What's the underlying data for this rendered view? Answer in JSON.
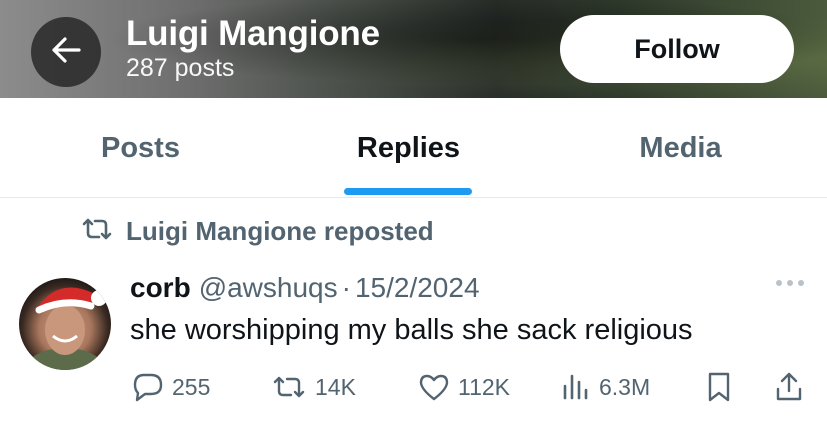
{
  "header": {
    "name": "Luigi Mangione",
    "post_count": "287 posts",
    "follow_label": "Follow"
  },
  "tabs": [
    {
      "label": "Posts",
      "active": false
    },
    {
      "label": "Replies",
      "active": true
    },
    {
      "label": "Media",
      "active": false
    }
  ],
  "repost_banner": "Luigi Mangione reposted",
  "tweet": {
    "author_name": "corb",
    "handle": "@awshuqs",
    "separator": "·",
    "date": "15/2/2024",
    "text": "she worshipping my balls she sack religious",
    "stats": {
      "replies": "255",
      "reposts": "14K",
      "likes": "112K",
      "views": "6.3M"
    }
  },
  "colors": {
    "accent": "#1d9bf0",
    "muted": "#536471",
    "text": "#0f1419"
  },
  "icons": [
    "back-arrow-icon",
    "repost-icon",
    "more-icon",
    "reply-icon",
    "like-icon",
    "views-icon",
    "bookmark-icon",
    "share-icon"
  ]
}
